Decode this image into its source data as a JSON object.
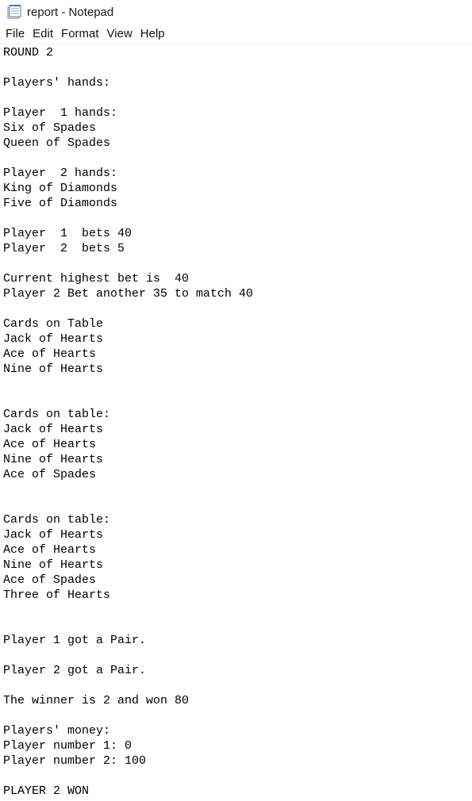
{
  "window": {
    "title": "report - Notepad",
    "icon": "notepad-icon"
  },
  "menu": [
    "File",
    "Edit",
    "Format",
    "View",
    "Help"
  ],
  "document": {
    "lines": [
      "ROUND 2",
      "",
      "Players' hands:",
      "",
      "Player  1 hands:",
      "Six of Spades",
      "Queen of Spades",
      "",
      "Player  2 hands:",
      "King of Diamonds",
      "Five of Diamonds",
      "",
      "Player  1  bets 40",
      "Player  2  bets 5",
      "",
      "Current highest bet is  40",
      "Player 2 Bet another 35 to match 40",
      "",
      "Cards on Table",
      "Jack of Hearts",
      "Ace of Hearts",
      "Nine of Hearts",
      "",
      "",
      "Cards on table:",
      "Jack of Hearts",
      "Ace of Hearts",
      "Nine of Hearts",
      "Ace of Spades",
      "",
      "",
      "Cards on table:",
      "Jack of Hearts",
      "Ace of Hearts",
      "Nine of Hearts",
      "Ace of Spades",
      "Three of Hearts",
      "",
      "",
      "Player 1 got a Pair.",
      "",
      "Player 2 got a Pair.",
      "",
      "The winner is 2 and won 80",
      "",
      "Players' money:",
      "Player number 1: 0",
      "Player number 2: 100",
      "",
      "PLAYER 2 WON"
    ]
  }
}
